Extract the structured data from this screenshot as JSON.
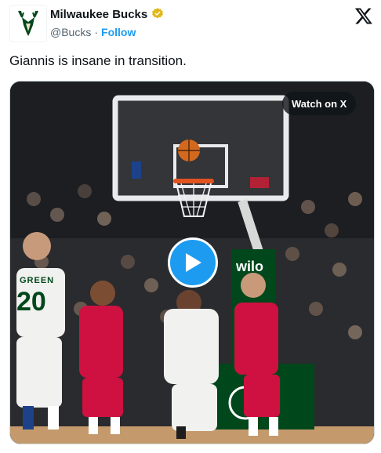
{
  "account": {
    "name": "Milwaukee Bucks",
    "handle": "@Bucks",
    "separator": "·",
    "follow_label": "Follow",
    "verified_color": "#e2b719"
  },
  "icons": {
    "logo": "bucks-deer-logo",
    "verified": "gold-verified-badge-icon",
    "platform": "x-logo-icon",
    "play": "play-icon"
  },
  "tweet": {
    "text": "Giannis is insane in transition."
  },
  "media": {
    "watch_label": "Watch on X",
    "jersey_green": "GREEN",
    "jersey_number_left": "20",
    "stanchion_brand": "wilo",
    "colors": {
      "bucks_green": "#00471b",
      "rockets_red": "#ce1141",
      "accent_blue": "#1d9bf0"
    }
  }
}
